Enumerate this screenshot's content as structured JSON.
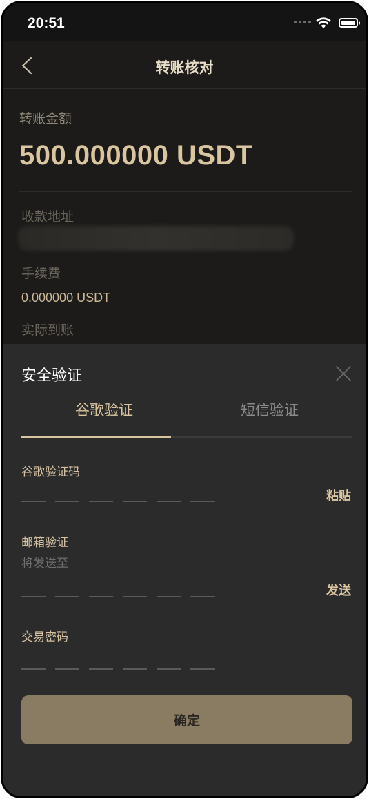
{
  "status_bar": {
    "time": "20:51"
  },
  "nav": {
    "title": "转账核对"
  },
  "transfer": {
    "amount_label": "转账金额",
    "amount_value": "500.000000 USDT",
    "address_label": "收款地址",
    "fee_label": "手续费",
    "fee_value": "0.000000 USDT",
    "actual_label": "实际到账"
  },
  "security": {
    "title": "安全验证",
    "tabs": [
      {
        "label": "谷歌验证"
      },
      {
        "label": "短信验证"
      }
    ],
    "google_label": "谷歌验证码",
    "paste_label": "粘贴",
    "email_label": "邮箱验证",
    "email_send_to": "将发送至",
    "send_label": "发送",
    "password_label": "交易密码",
    "confirm_label": "确定"
  },
  "colors": {
    "accent": "#d9c6a0",
    "background": "#1c1b1a",
    "sheet": "#2b2b2b",
    "button": "#8a7c63"
  }
}
